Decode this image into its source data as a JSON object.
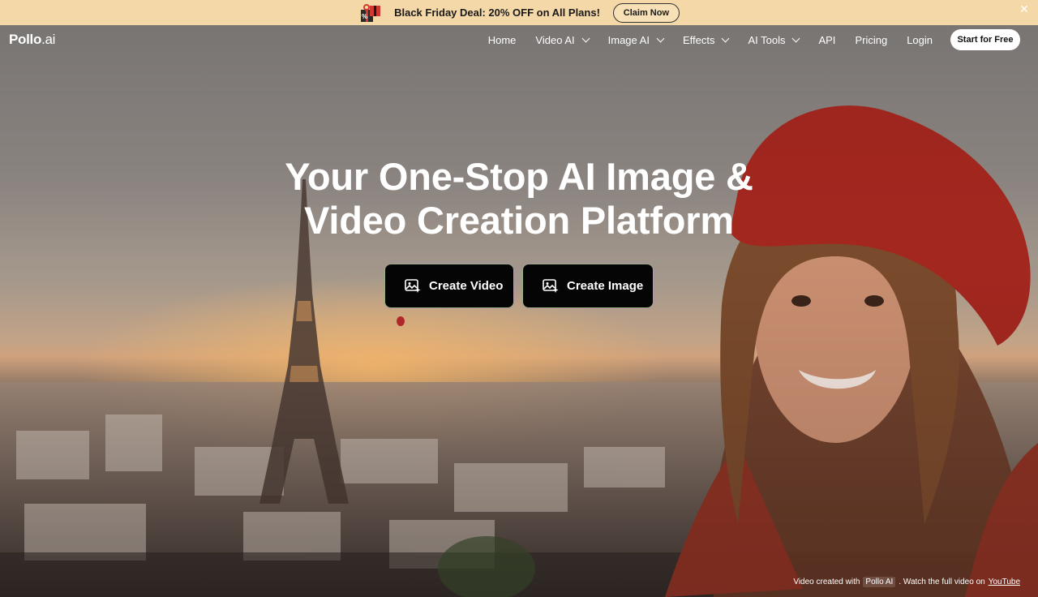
{
  "promo": {
    "text": "Black Friday Deal: 20% OFF on All Plans!",
    "button": "Claim Now",
    "close": "✕",
    "gift_icon": "gift-box-icon",
    "background": "#f5d8a8"
  },
  "nav": {
    "logo_main": "Pollo",
    "logo_suffix": ".ai",
    "items": [
      {
        "label": "Home",
        "dropdown": false
      },
      {
        "label": "Video AI",
        "dropdown": true
      },
      {
        "label": "Image AI",
        "dropdown": true
      },
      {
        "label": "Effects",
        "dropdown": true
      },
      {
        "label": "AI Tools",
        "dropdown": true
      },
      {
        "label": "API",
        "dropdown": false
      },
      {
        "label": "Pricing",
        "dropdown": false
      },
      {
        "label": "Login",
        "dropdown": false
      }
    ],
    "cta": "Start for Free"
  },
  "hero": {
    "headline_line1": "Your One-Stop AI Image &",
    "headline_line2": "Video Creation Platform",
    "create_video": "Create Video",
    "create_image": "Create Image",
    "cta_icon": "image-sparkle-icon"
  },
  "credit": {
    "prefix": "Video created with",
    "tool": "Pollo AI",
    "middle": ". Watch the full video on",
    "link": "YouTube"
  }
}
